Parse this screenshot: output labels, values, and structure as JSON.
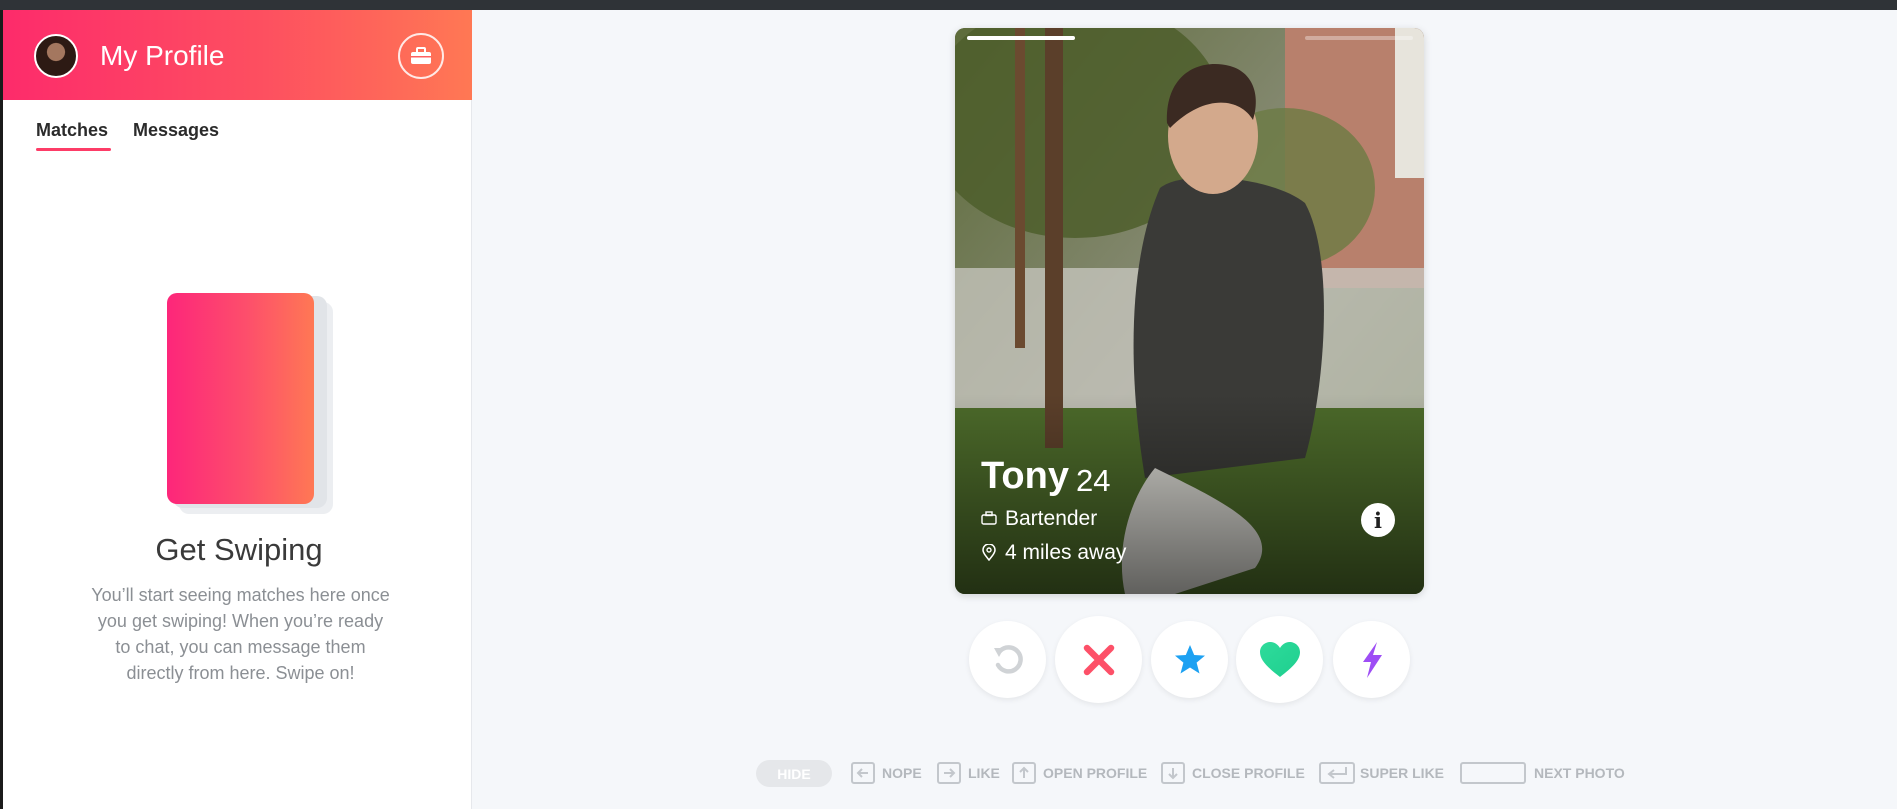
{
  "header": {
    "title": "My Profile",
    "avatar": "user-avatar",
    "work_mode_icon": "briefcase-icon"
  },
  "tabs": [
    {
      "label": "Matches",
      "active": true
    },
    {
      "label": "Messages",
      "active": false
    }
  ],
  "empty_state": {
    "title": "Get Swiping",
    "body": "You’ll start seeing matches here once you get swiping! When you’re ready to chat, you can message them directly from here. Swipe on!"
  },
  "profile_card": {
    "name": "Tony",
    "age": "24",
    "job": "Bartender",
    "distance": "4 miles away",
    "photo_count": 4,
    "current_photo": 1
  },
  "actions": [
    {
      "name": "rewind",
      "icon": "rewind-icon"
    },
    {
      "name": "nope",
      "icon": "x-icon"
    },
    {
      "name": "super-like",
      "icon": "star-icon"
    },
    {
      "name": "like",
      "icon": "heart-icon"
    },
    {
      "name": "boost",
      "icon": "lightning-icon"
    }
  ],
  "shortcuts": {
    "hide": "HIDE",
    "items": [
      {
        "key": "left-arrow",
        "label": "NOPE"
      },
      {
        "key": "right-arrow",
        "label": "LIKE"
      },
      {
        "key": "up-arrow",
        "label": "OPEN PROFILE"
      },
      {
        "key": "down-arrow",
        "label": "CLOSE PROFILE"
      },
      {
        "key": "enter",
        "label": "SUPER LIKE"
      },
      {
        "key": "space",
        "label": "NEXT PHOTO"
      }
    ]
  },
  "colors": {
    "brand_start": "#fd267a",
    "brand_end": "#ff7854",
    "nope": "#fd5068",
    "super_like": "#1da1f2",
    "like": "#2edb9b",
    "boost": "#9e4df5",
    "rewind": "#d0d3d6"
  }
}
